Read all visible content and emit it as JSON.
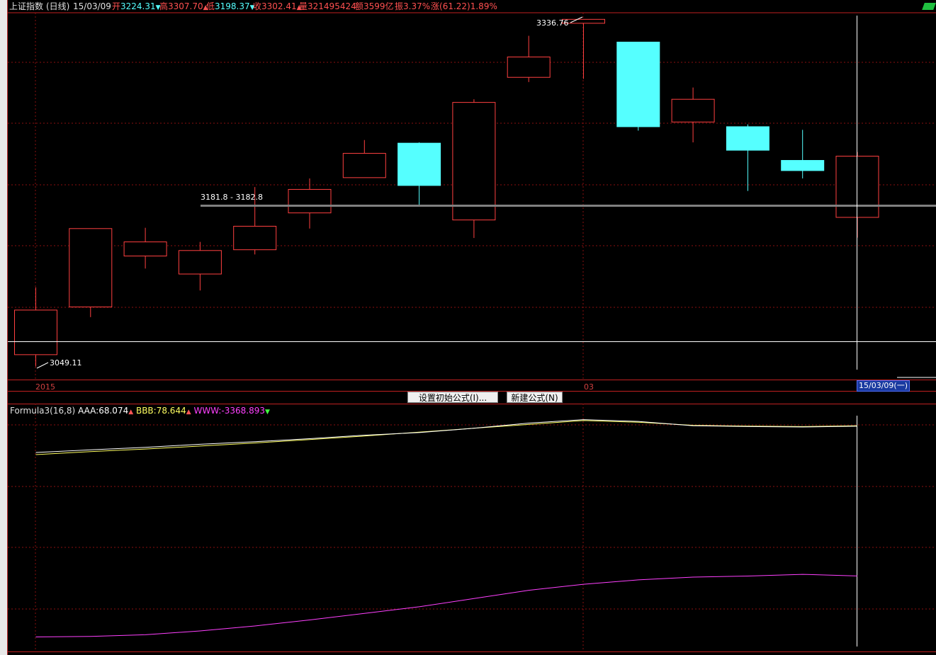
{
  "header": {
    "name": "上证指数",
    "period": "(日线)",
    "date": "15/03/09",
    "open_label": "开",
    "open": "3224.31",
    "high_label": "高",
    "high": "3307.70",
    "low_label": "低",
    "low": "3198.37",
    "close_label": "收",
    "close": "3302.41",
    "volume_label": "量",
    "volume": "321495424",
    "amount_label": "额",
    "amount": "3599亿",
    "amplitude_label": "振",
    "amplitude": "3.37%",
    "change_label": "涨",
    "change": "(61.22)1.89%"
  },
  "price_marks": {
    "max_label": "3336.76",
    "min_label": "3049.11",
    "range_label": "3181.8 - 3182.8"
  },
  "axis": {
    "year_label": "2015",
    "month_label": "03",
    "cursor_date": "15/03/09(一)"
  },
  "buttons": {
    "set_formula": "设置初始公式(I)...",
    "new_formula": "新建公式(N)"
  },
  "indicator": {
    "name": "Formula3(16,8)",
    "aaa_label": "AAA:",
    "aaa": "68.074",
    "bbb_label": "BBB:",
    "bbb": "78.644",
    "www_label": "WWW:",
    "www": "-3368.893"
  },
  "colors": {
    "up": "#ff4040",
    "down": "#55ffff",
    "grid": "#8a1010",
    "aaa": "#ffffff",
    "bbb": "#ffff60",
    "www": "#ff40ff"
  },
  "chart_data": {
    "type": "candlestick",
    "series": [
      {
        "o": 3049.1,
        "c": 3106.0,
        "h": 3135.0,
        "l": 3034.0,
        "dir": "up"
      },
      {
        "o": 3110.0,
        "c": 3210.0,
        "h": 3210.0,
        "l": 3097.0,
        "dir": "up"
      },
      {
        "o": 3175.0,
        "c": 3193.0,
        "h": 3211.0,
        "l": 3159.0,
        "dir": "up"
      },
      {
        "o": 3152.0,
        "c": 3182.0,
        "h": 3193.0,
        "l": 3131.0,
        "dir": "up"
      },
      {
        "o": 3183.0,
        "c": 3213.0,
        "h": 3263.0,
        "l": 3177.0,
        "dir": "up"
      },
      {
        "o": 3230.0,
        "c": 3260.0,
        "h": 3274.0,
        "l": 3210.0,
        "dir": "up"
      },
      {
        "o": 3275.0,
        "c": 3306.0,
        "h": 3323.0,
        "l": 3275.0,
        "dir": "up"
      },
      {
        "o": 3319.0,
        "c": 3265.0,
        "h": 3320.0,
        "l": 3239.0,
        "dir": "down"
      },
      {
        "o": 3221.0,
        "c": 3371.0,
        "h": 3375.0,
        "l": 3198.0,
        "dir": "up"
      },
      {
        "o": 3403.0,
        "c": 3429.0,
        "h": 3456.0,
        "l": 3397.0,
        "dir": "up"
      },
      {
        "o": 3472.0,
        "c": 3477.0,
        "h": 3477.0,
        "l": 3401.0,
        "dir": "up"
      },
      {
        "o": 3448.0,
        "c": 3340.0,
        "h": 3448.0,
        "l": 3335.0,
        "dir": "down"
      },
      {
        "o": 3346.0,
        "c": 3375.0,
        "h": 3390.0,
        "l": 3320.0,
        "dir": "up"
      },
      {
        "o": 3340.0,
        "c": 3310.0,
        "h": 3343.0,
        "l": 3258.0,
        "dir": "down"
      },
      {
        "o": 3297.0,
        "c": 3284.0,
        "h": 3336.0,
        "l": 3274.0,
        "dir": "down"
      },
      {
        "o": 3224.31,
        "c": 3302.41,
        "h": 3307.7,
        "l": 3198.37,
        "dir": "up"
      }
    ],
    "aaa_line": [
      62.0,
      62.6,
      63.2,
      63.9,
      64.5,
      65.2,
      66.0,
      66.6,
      67.6,
      68.8,
      69.6,
      69.2,
      68.2,
      68.0,
      67.9,
      68.074
    ],
    "bbb_line": [
      61.5,
      62.2,
      62.8,
      63.5,
      64.2,
      65.0,
      65.8,
      66.7,
      67.6,
      68.5,
      69.4,
      69.0,
      68.3,
      68.1,
      68.0,
      68.2
    ],
    "www_line": [
      -3480,
      -3479,
      -3476,
      -3469,
      -3460,
      -3449,
      -3437,
      -3425,
      -3410,
      -3395,
      -3384,
      -3376,
      -3371,
      -3369,
      -3366,
      -3368.893
    ],
    "grid": true
  }
}
